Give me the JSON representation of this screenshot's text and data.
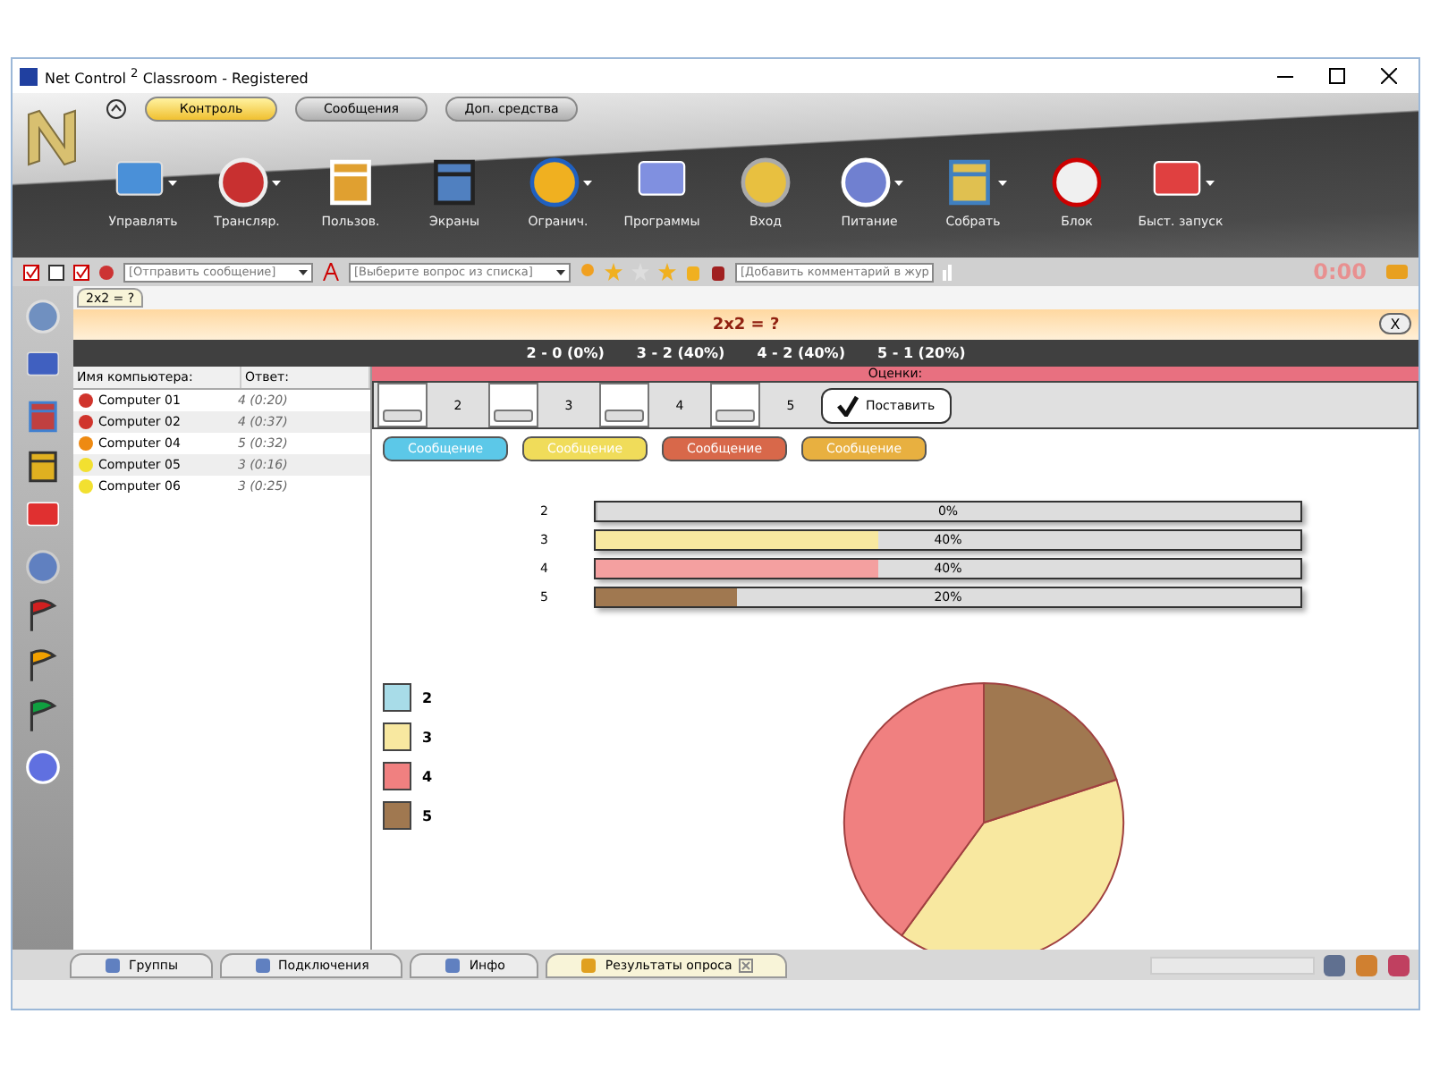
{
  "window": {
    "title": "Net Control $^{2}$ Classroom - Registered"
  },
  "top_tabs": [
    {
      "label": "Контроль",
      "selected": true
    },
    {
      "label": "Сообщения",
      "selected": false
    },
    {
      "label": "Доп. средства",
      "selected": false
    }
  ],
  "toolbar": [
    {
      "label": "Управлять",
      "dropdown": true
    },
    {
      "label": "Трансляр.",
      "dropdown": true
    },
    {
      "label": "Пользов.",
      "dropdown": false
    },
    {
      "label": "Экраны",
      "dropdown": false
    },
    {
      "label": "Огранич.",
      "dropdown": true
    },
    {
      "label": "Программы",
      "dropdown": false
    },
    {
      "label": "Вход",
      "dropdown": false
    },
    {
      "label": "Питание",
      "dropdown": true
    },
    {
      "label": "Собрать",
      "dropdown": true
    },
    {
      "label": "Блок",
      "dropdown": false
    },
    {
      "label": "Быст. запуск",
      "dropdown": true
    }
  ],
  "quick_bar": {
    "message_placeholder": "[Отправить сообщение]",
    "question_placeholder": "[Выберите вопрос из списка]",
    "comment_placeholder": "[Добавить комментарий в жур",
    "timer": "0:00"
  },
  "question_tab": "2x2 = ?",
  "question_title": "2x2 = ?",
  "close_label": "X",
  "summary": [
    "2 - 0 (0%)",
    "3 - 2 (40%)",
    "4 - 2 (40%)",
    "5 - 1 (20%)"
  ],
  "table": {
    "columns": [
      "Имя компьютера:",
      "Ответ:"
    ],
    "rows": [
      {
        "name": "Computer 01",
        "answer": "4 (0:20)",
        "color": "#d0342c"
      },
      {
        "name": "Computer 02",
        "answer": "4 (0:37)",
        "color": "#d0342c"
      },
      {
        "name": "Computer 04",
        "answer": "5 (0:32)",
        "color": "#ee8a12"
      },
      {
        "name": "Computer 05",
        "answer": "3 (0:16)",
        "color": "#f2e030"
      },
      {
        "name": "Computer 06",
        "answer": "3 (0:25)",
        "color": "#f2e030"
      }
    ]
  },
  "grades": {
    "title": "Оценки:",
    "items": [
      "2",
      "3",
      "4",
      "5"
    ],
    "button": "Поставить"
  },
  "message_buttons": [
    {
      "label": "Сообщение",
      "color": "#5cc8e8"
    },
    {
      "label": "Сообщение",
      "color": "#f0dc5a"
    },
    {
      "label": "Сообщение",
      "color": "#d8684a"
    },
    {
      "label": "Сообщение",
      "color": "#e8b040"
    }
  ],
  "bars": [
    {
      "label": "2",
      "level": 0,
      "reading": "0%"
    },
    {
      "label": "3",
      "level": 0.4,
      "reading": "40%",
      "color": "#f8e8a0"
    },
    {
      "label": "4",
      "level": 0.4,
      "reading": "40%",
      "color": "#f4a0a0"
    },
    {
      "label": "5",
      "level": 0.2,
      "reading": "20%",
      "color": "#a07850"
    }
  ],
  "legend": [
    {
      "color": "#a8dce8"
    },
    {
      "color": "#f8e8a0"
    },
    {
      "color": "#f08080"
    },
    {
      "color": "#a07850"
    }
  ],
  "chart_data": {
    "type": "pie",
    "categories": [
      "2",
      "3",
      "4",
      "5"
    ],
    "values": [
      0,
      40,
      40,
      20
    ]
  },
  "bottom_tabs": [
    {
      "label": "Группы",
      "selected": false,
      "closable": false
    },
    {
      "label": "Подключения",
      "selected": false,
      "closable": false
    },
    {
      "label": "Инфо",
      "selected": false,
      "closable": false
    },
    {
      "label": "Результаты опроса",
      "selected": true,
      "closable": true
    }
  ]
}
